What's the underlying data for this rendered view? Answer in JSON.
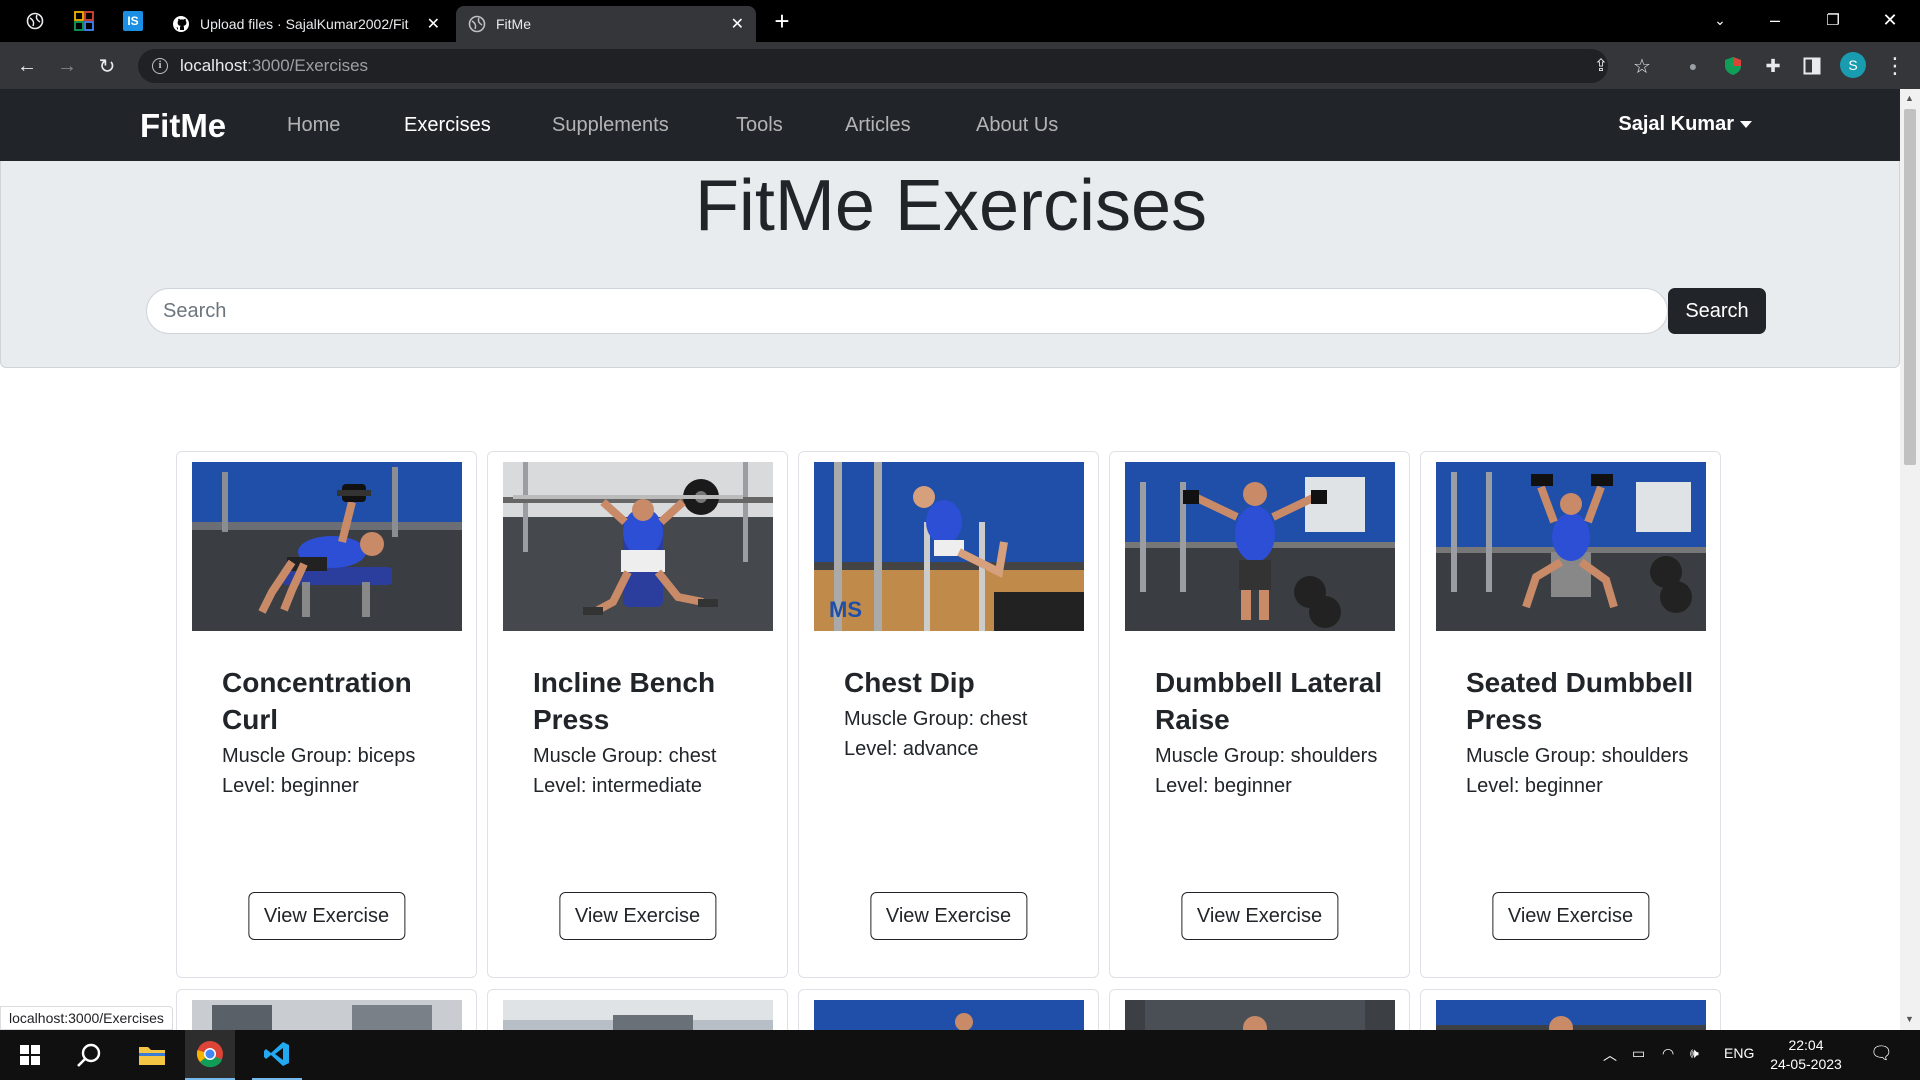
{
  "browser": {
    "tabs": [
      {
        "title": "Upload files · SajalKumar2002/Fit"
      },
      {
        "title": "FitMe"
      }
    ],
    "pinned_badge": "IS",
    "url_host": "localhost",
    "url_path": ":3000/Exercises",
    "profile_initial": "S",
    "status_url": "localhost:3000/Exercises"
  },
  "navbar": {
    "brand": "FitMe",
    "links": [
      {
        "label": "Home"
      },
      {
        "label": "Exercises"
      },
      {
        "label": "Supplements"
      },
      {
        "label": "Tools"
      },
      {
        "label": "Articles"
      },
      {
        "label": "About Us"
      }
    ],
    "active_link": "Exercises",
    "user": "Sajal Kumar"
  },
  "hero": {
    "title": "FitMe Exercises",
    "search_placeholder": "Search",
    "search_button": "Search"
  },
  "cards": [
    {
      "title": "Concentration Curl",
      "muscle": "Muscle Group: biceps",
      "level": "Level: beginner",
      "button": "View Exercise"
    },
    {
      "title": "Incline Bench Press",
      "muscle": "Muscle Group: chest",
      "level": "Level: intermediate",
      "button": "View Exercise"
    },
    {
      "title": "Chest Dip",
      "muscle": "Muscle Group: chest",
      "level": "Level: advance",
      "button": "View Exercise"
    },
    {
      "title": "Dumbbell Lateral Raise",
      "muscle": "Muscle Group: shoulders",
      "level": "Level: beginner",
      "button": "View Exercise"
    },
    {
      "title": "Seated Dumbbell Press",
      "muscle": "Muscle Group: shoulders",
      "level": "Level: beginner",
      "button": "View Exercise"
    }
  ],
  "taskbar": {
    "language": "ENG",
    "time": "22:04",
    "date": "24-05-2023"
  },
  "colors": {
    "navbar_bg": "#212529",
    "hero_bg": "#e9ecef",
    "gym_floor": "#3a3d42",
    "gym_wall": "#1f4fa8",
    "athlete_shirt": "#2d4fd6"
  }
}
